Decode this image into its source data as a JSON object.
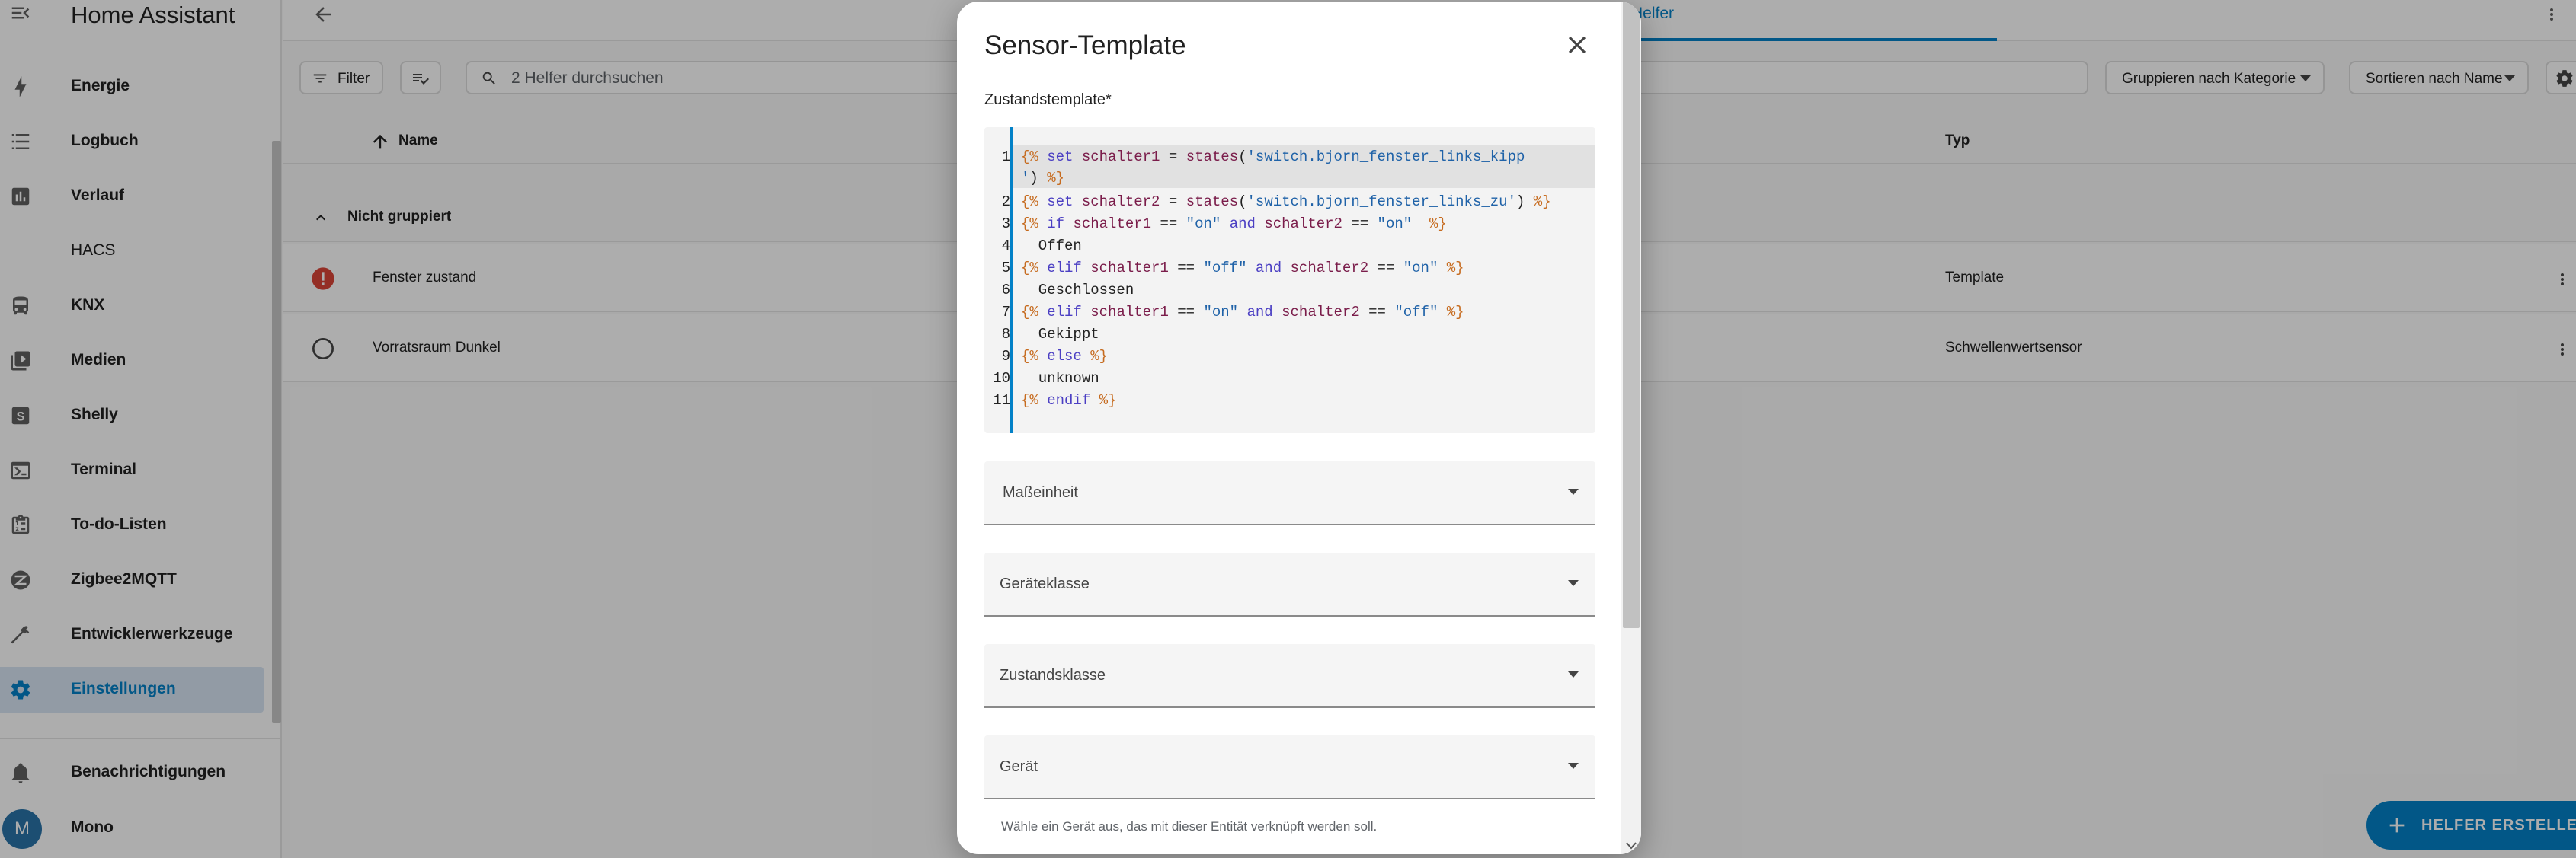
{
  "app": {
    "title": "Home Assistant"
  },
  "sidebar": {
    "items": [
      {
        "label": "Energie",
        "icon": "lightning-bolt-icon"
      },
      {
        "label": "Logbuch",
        "icon": "list-icon"
      },
      {
        "label": "Verlauf",
        "icon": "chart-box-icon"
      },
      {
        "label": "HACS",
        "icon": ""
      },
      {
        "label": "KNX",
        "icon": "bus-icon"
      },
      {
        "label": "Medien",
        "icon": "play-box-multiple-icon"
      },
      {
        "label": "Shelly",
        "icon": "shelly-s-icon"
      },
      {
        "label": "Terminal",
        "icon": "console-icon"
      },
      {
        "label": "To-do-Listen",
        "icon": "clipboard-list-icon"
      },
      {
        "label": "Zigbee2MQTT",
        "icon": "zigbee-icon"
      },
      {
        "label": "Entwicklerwerkzeuge",
        "icon": "hammer-icon"
      },
      {
        "label": "Einstellungen",
        "icon": "cog-icon",
        "active": true
      }
    ],
    "notifications_label": "Benachrichtigungen",
    "user": {
      "initial": "M",
      "name": "Mono"
    }
  },
  "header": {
    "active_tab": "Helfer"
  },
  "toolbar": {
    "filter_label": "Filter",
    "search_placeholder": "2 Helfer durchsuchen",
    "group_label": "Gruppieren nach Kategorie",
    "sort_label": "Sortieren nach Name"
  },
  "table": {
    "columns": {
      "name": "Name",
      "type": "Typ"
    },
    "group": "Nicht gruppiert",
    "rows": [
      {
        "name": "Fenster zustand",
        "type": "Template",
        "status": "error"
      },
      {
        "name": "Vorratsraum Dunkel",
        "type": "Schwellenwertsensor",
        "status": "ok"
      }
    ]
  },
  "fab": {
    "label": "HELFER ERSTELLEN"
  },
  "dialog": {
    "title": "Sensor-Template",
    "template_label": "Zustandstemplate*",
    "line_numbers": [
      "1",
      "2",
      "3",
      "4",
      "5",
      "6",
      "7",
      "8",
      "9",
      "10",
      "11"
    ],
    "fields": {
      "unit": "Maßeinheit",
      "device_class": "Geräteklasse",
      "state_class": "Zustandsklasse",
      "device": "Gerät"
    },
    "device_helper": "Wähle ein Gerät aus, das mit dieser Entität verknüpft werden soll."
  },
  "colors": {
    "accent": "#0381c7",
    "error": "#db4437"
  }
}
